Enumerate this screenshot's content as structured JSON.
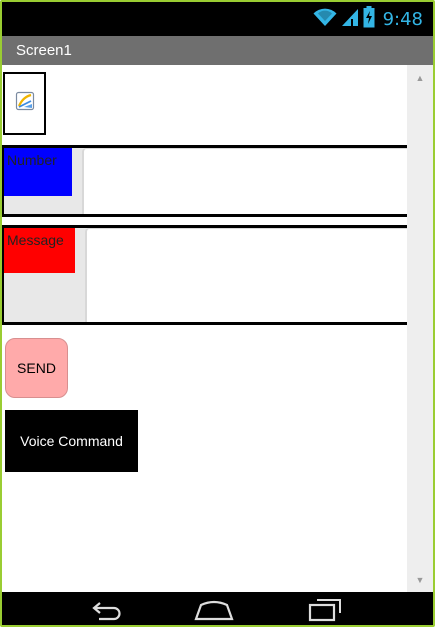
{
  "status_bar": {
    "time": "9:48",
    "icons": [
      "wifi-icon",
      "cell-signal-icon",
      "battery-charging-icon"
    ]
  },
  "title_bar": {
    "title": "Screen1"
  },
  "image": {
    "icon": "broken-image-icon"
  },
  "number_row": {
    "label": "Number",
    "label_color": "#0000ff",
    "input_value": ""
  },
  "message_row": {
    "label": "Message",
    "label_color": "#ff0000",
    "input_value": ""
  },
  "buttons": {
    "send": "SEND",
    "send_color": "#ffaaaa",
    "voice": "Voice Command",
    "voice_color": "#000000"
  },
  "nav_bar": {
    "icons": [
      "back-icon",
      "home-icon",
      "recents-icon"
    ]
  }
}
